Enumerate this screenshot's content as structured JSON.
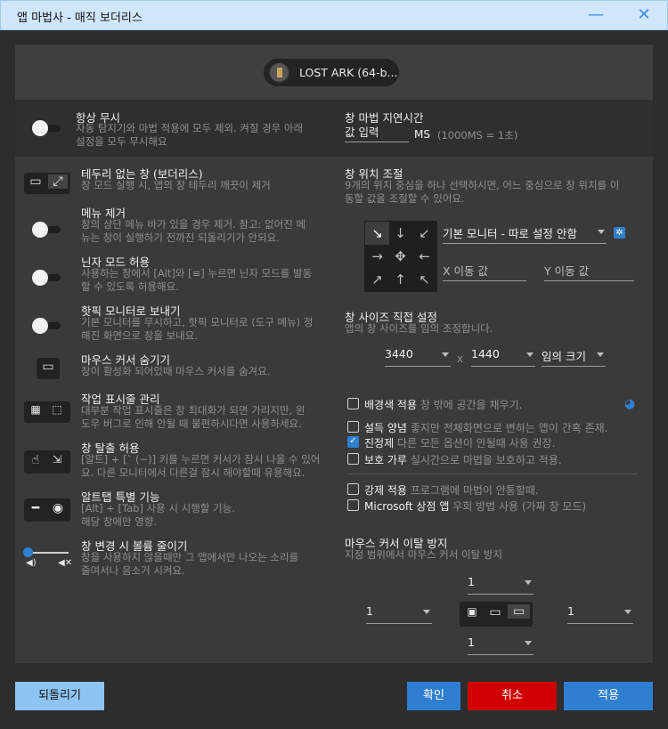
{
  "window": {
    "title": "앱 마법사 - 매직 보더리스",
    "minimize_icon": "minimize-icon",
    "close_icon": "close-icon"
  },
  "app": {
    "name": "LOST ARK (64-b..."
  },
  "ignore": {
    "title": "항상 무시",
    "desc1": "자동 탐지기와 마법 적용에 모두 제외. 켜질 경우 아래",
    "desc2": "설정을 모두 무시해요"
  },
  "delay": {
    "title": "창 마법 지연시간",
    "placeholder": "값 입력",
    "unit": "MS",
    "hint": "(1000MS = 1초)"
  },
  "borderless": {
    "title": "테두리 없는 창 (보더리스)",
    "desc": "창 모드 실행 시, 앱의 창 테두리 깨끗이 제거"
  },
  "position": {
    "title": "창 위치 조절",
    "desc1": "9개의 위치 중심을 하나 선택하시면, 어느 중심으로 창 위치를 이",
    "desc2": "동할 값을 조절할 수 있어요.",
    "monitor": "기본 모니터 - 따로 설정 안함",
    "x_placeholder": "X 이동 값",
    "y_placeholder": "Y 이동 값",
    "arrows": [
      "↘",
      "↓",
      "↙",
      "→",
      "✥",
      "←",
      "↗",
      "↑",
      "↖"
    ]
  },
  "menu": {
    "title": "메뉴 제거",
    "desc1": "창의 상단 메뉴 바가 있을 경우 제거. 참고: 없어진 메",
    "desc2": "뉴는 창이 실행하기 전까진 되돌리기가 안되요."
  },
  "ninja": {
    "title": "닌자 모드 허용",
    "desc1": "사용하는 창에서 [Alt]와 [≡] 누르면 닌자 모드를 발동",
    "desc2": "할 수 있도록 허용해요."
  },
  "hotkey_monitor": {
    "title": "핫픽 모니터로 보내기",
    "desc1": "기본 모니터를 무시하고, 핫픽 모니터로 (도구 메뉴) 정",
    "desc2": "해진 화면으로 창을 보내요."
  },
  "size": {
    "title": "창 사이즈 직접 설정",
    "desc": "앱의 창 사이즈를 임의 조정합니다.",
    "width": "3440",
    "x": "x",
    "height": "1440",
    "preset": "임의 크기"
  },
  "cursor_hide": {
    "title": "마우스 커서 숨기기",
    "desc": "창이 활성화 되어있때 마우스 커서를 숨겨요."
  },
  "taskbar": {
    "title": "작업 표시줄 관리",
    "desc1": "대부분 작업 표시줄은 창 최대화가 되면 가리지만, 윈",
    "desc2": "도우 버그로 인해 안될 때 불편하시다면 사용하세요."
  },
  "options": [
    {
      "label": "배경색 적용",
      "desc": "창 밖에 공간을 채우기.",
      "checked": false
    },
    {
      "label": "설득 양념",
      "desc": "좋지만 전체화면으로 변하는 앱이 간혹 존재.",
      "checked": false
    },
    {
      "label": "진정제",
      "desc": "다른 모든 옵션이 안될때 사용 권장.",
      "checked": true
    },
    {
      "label": "보호 가루",
      "desc": "실시간으로 마법을 보호하고 적용.",
      "checked": false
    },
    {
      "label": "강제 적용",
      "desc": "프로그램에 마법이 안통할때.",
      "checked": false
    },
    {
      "label": "Microsoft 상점 앱",
      "desc": "우회 방법 사용 (가짜 창 모드)",
      "checked": false
    }
  ],
  "escape": {
    "title": "창 탈출 허용",
    "desc1": "[알트] + [` (~)] 키를 누르면 커서가 잠시 나올 수 있어",
    "desc2": "요. 다른 모니터에서 다른걸 잠시 해야할때 유용해요."
  },
  "alttab": {
    "title": "알트탭 특별 기능",
    "desc1": "[Alt] + [Tab] 사용 시 시행할 기능.",
    "desc2": "해당 창에만 영향."
  },
  "volume": {
    "title": "창 변경 시 볼륨 줄이기",
    "desc1": "창을 사용하지 않을때만 그 앱에서만 나오는 소리를",
    "desc2": "줄여서나 음소거 시켜요.",
    "level": 0
  },
  "cursor_lock": {
    "title": "마우스 커서 이탈 방지",
    "desc": "지정 범위에서 마우스 커서 이탈 방지",
    "top": "1",
    "left": "1",
    "right": "1",
    "bottom": "1"
  },
  "footer": {
    "reset": "되돌리기",
    "ok": "확인",
    "cancel": "취소",
    "apply": "적용"
  },
  "colors": {
    "accent": "#2f7fd0",
    "cancel": "#d10000",
    "reset": "#8ec4f2"
  }
}
